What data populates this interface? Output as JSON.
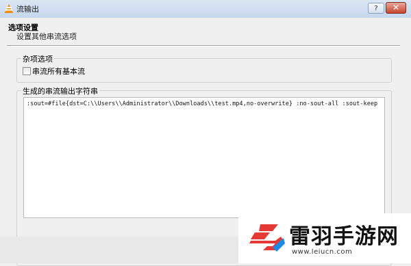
{
  "window": {
    "title": "流输出",
    "help_label": "?",
    "close_label": "✕"
  },
  "header": {
    "title": "选项设置",
    "subtitle": "设置其他串流选项"
  },
  "misc_group": {
    "label": "杂项选项",
    "checkbox_label": "串流所有基本流",
    "checkbox_checked": false
  },
  "output_group": {
    "label": "生成的串流输出字符串",
    "value": ":sout=#file{dst=C:\\\\Users\\\\Administrator\\\\Downloads\\\\test.mp4,no-overwrite} :no-sout-all :sout-keep"
  },
  "watermark": {
    "text": "雷羽手游网",
    "url": "www.leiucn.com"
  },
  "colors": {
    "logo_red": "#e53935",
    "logo_blue": "#1e88e5"
  }
}
